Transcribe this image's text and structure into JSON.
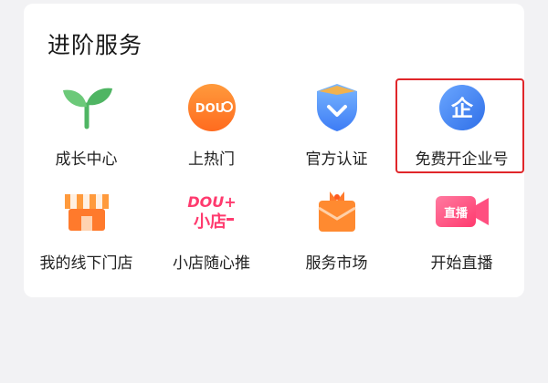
{
  "section": {
    "title": "进阶服务"
  },
  "items": [
    {
      "label": "成长中心",
      "icon": "sprout-icon"
    },
    {
      "label": "上热门",
      "icon": "dou-plus-icon",
      "badge": "DOU"
    },
    {
      "label": "官方认证",
      "icon": "verified-shield-icon"
    },
    {
      "label": "免费开企业号",
      "icon": "enterprise-icon",
      "badge": "企",
      "highlighted": true
    },
    {
      "label": "我的线下门店",
      "icon": "storefront-icon"
    },
    {
      "label": "小店随心推",
      "icon": "dou-plus-shop-icon",
      "badge_top": "DOU+",
      "badge_bottom": "小店"
    },
    {
      "label": "服务市场",
      "icon": "gift-box-icon"
    },
    {
      "label": "开始直播",
      "icon": "live-camera-icon",
      "badge": "直播"
    }
  ],
  "colors": {
    "highlight_border": "#e0262a",
    "accent_orange": "#ff7a2c",
    "accent_blue": "#3d8bff",
    "accent_pink": "#ff3a6e",
    "accent_green": "#5cbf6a"
  }
}
